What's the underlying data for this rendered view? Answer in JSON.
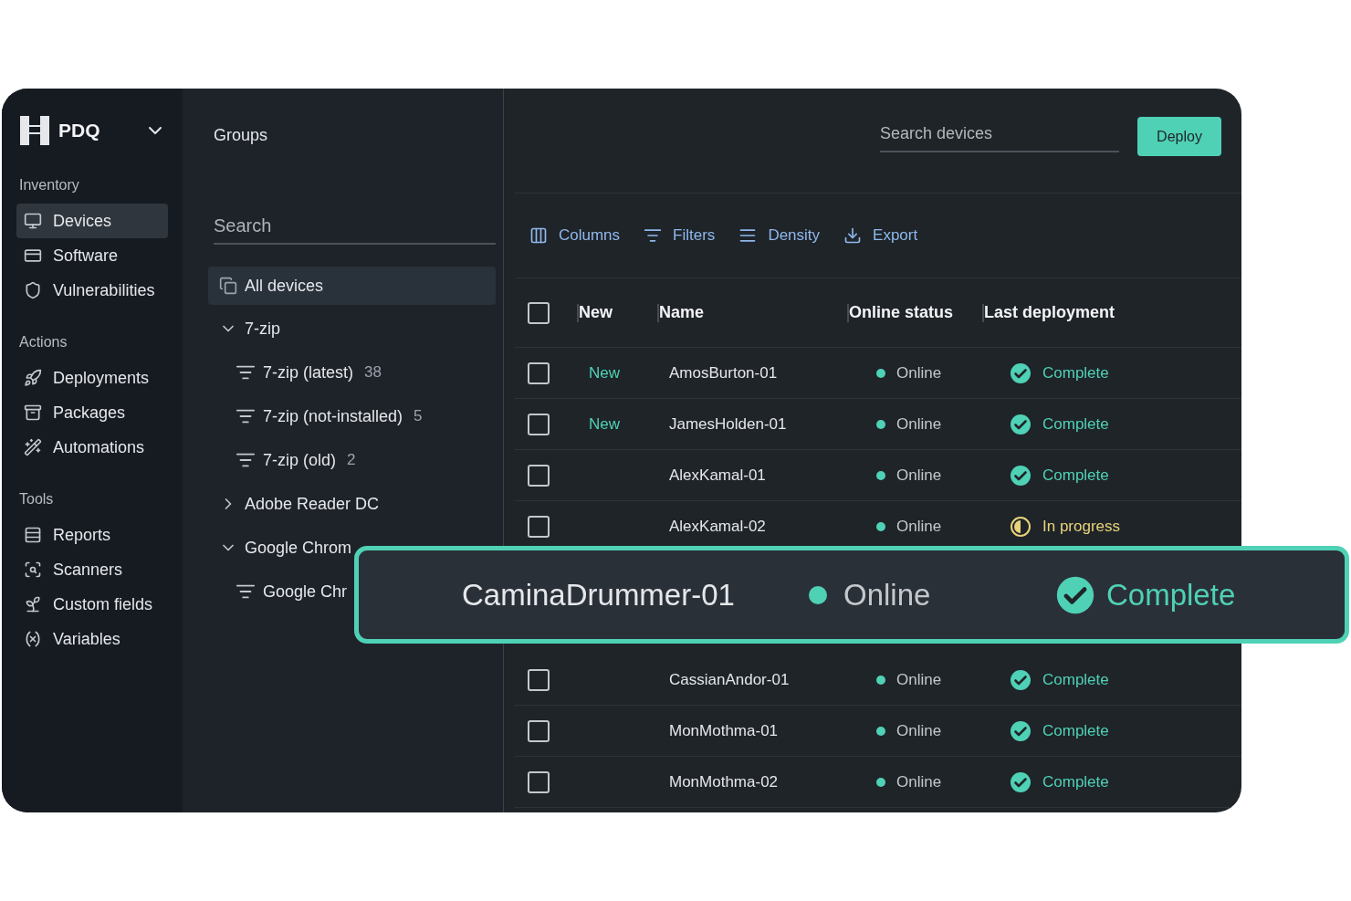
{
  "brand": {
    "name": "PDQ"
  },
  "sidebar": {
    "sections": [
      {
        "title": "Inventory",
        "items": [
          {
            "label": "Devices",
            "selected": true
          },
          {
            "label": "Software",
            "selected": false
          },
          {
            "label": "Vulnerabilities",
            "selected": false
          }
        ]
      },
      {
        "title": "Actions",
        "items": [
          {
            "label": "Deployments",
            "selected": false
          },
          {
            "label": "Packages",
            "selected": false
          },
          {
            "label": "Automations",
            "selected": false
          }
        ]
      },
      {
        "title": "Tools",
        "items": [
          {
            "label": "Reports",
            "selected": false
          },
          {
            "label": "Scanners",
            "selected": false
          },
          {
            "label": "Custom fields",
            "selected": false
          },
          {
            "label": "Variables",
            "selected": false
          }
        ]
      }
    ]
  },
  "groups": {
    "title": "Groups",
    "search": {
      "placeholder": "Search"
    },
    "all_devices": {
      "label": "All devices",
      "selected": true
    },
    "tree": [
      {
        "label": "7-zip",
        "expanded": true,
        "children": [
          {
            "label": "7-zip (latest)",
            "count": "38"
          },
          {
            "label": "7-zip (not-installed)",
            "count": "5"
          },
          {
            "label": "7-zip (old)",
            "count": "2"
          }
        ]
      },
      {
        "label": "Adobe Reader DC",
        "expanded": false
      },
      {
        "label": "Google Chrom",
        "expanded": true,
        "children": [
          {
            "label": "Google Chr"
          }
        ]
      }
    ]
  },
  "search_devices": {
    "placeholder": "Search devices"
  },
  "deploy_button": "Deploy",
  "toolbar": [
    "Columns",
    "Filters",
    "Density",
    "Export"
  ],
  "table": {
    "select_all_checked": false,
    "columns": [
      "New",
      "Name",
      "Online status",
      "Last deployment"
    ],
    "rows_top": [
      {
        "checked": false,
        "new": "New",
        "name": "AmosBurton-01",
        "online": "Online",
        "deployment": {
          "kind": "complete",
          "label": "Complete"
        }
      },
      {
        "checked": false,
        "new": "New",
        "name": "JamesHolden-01",
        "online": "Online",
        "deployment": {
          "kind": "complete",
          "label": "Complete"
        }
      },
      {
        "checked": false,
        "name": "AlexKamal-01",
        "online": "Online",
        "deployment": {
          "kind": "complete",
          "label": "Complete"
        }
      },
      {
        "checked": false,
        "name": "AlexKamal-02",
        "online": "Online",
        "deployment": {
          "kind": "in_progress",
          "label": "In progress"
        }
      }
    ],
    "rows_bottom": [
      {
        "checked": false,
        "name": "CassianAndor-01",
        "online": "Online",
        "deployment": {
          "kind": "complete",
          "label": "Complete"
        }
      },
      {
        "checked": false,
        "name": "MonMothma-01",
        "online": "Online",
        "deployment": {
          "kind": "complete",
          "label": "Complete"
        }
      },
      {
        "checked": false,
        "name": "MonMothma-02",
        "online": "Online",
        "deployment": {
          "kind": "complete",
          "label": "Complete"
        }
      }
    ]
  },
  "highlight": {
    "name": "CaminaDrummer-01",
    "online": "Online",
    "deployment": {
      "kind": "complete",
      "label": "Complete"
    }
  }
}
